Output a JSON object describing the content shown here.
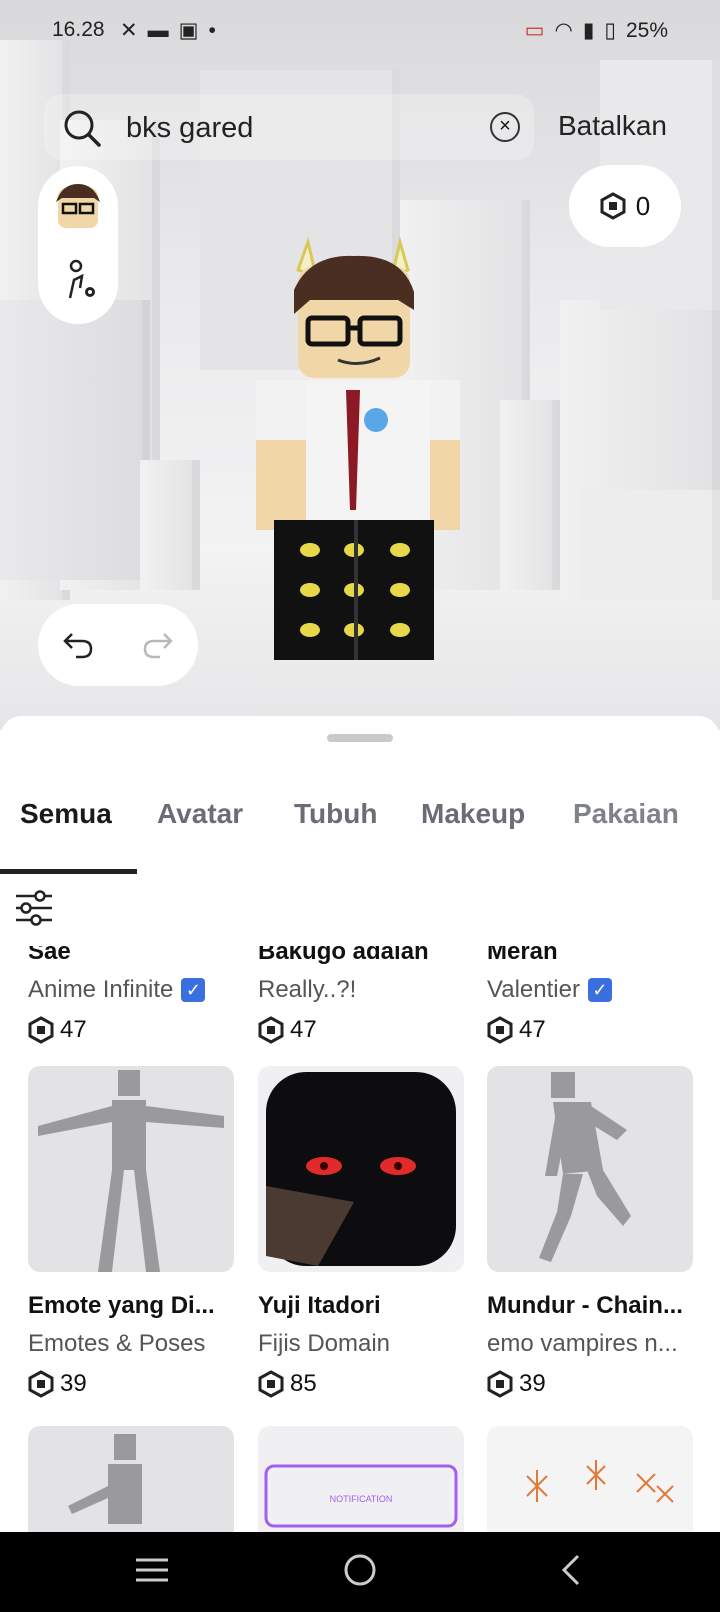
{
  "status_bar": {
    "time": "16.28",
    "battery": "25%"
  },
  "search": {
    "value": "bks gared",
    "cancel_label": "Batalkan"
  },
  "robux": {
    "balance": "0"
  },
  "tabs": [
    "Semua",
    "Avatar",
    "Tubuh",
    "Makeup",
    "Pakaian"
  ],
  "partial_row": [
    {
      "name": "Sae",
      "creator": "Anime Infinite",
      "verified": true,
      "price": "47"
    },
    {
      "name": "Bakugo adalah",
      "creator": "Really..?!",
      "verified": false,
      "price": "47"
    },
    {
      "name": "Meran",
      "creator": "Valentier",
      "verified": true,
      "price": "47"
    }
  ],
  "items": [
    {
      "name": "Emote yang Di...",
      "creator": "Emotes & Poses",
      "price": "39",
      "thumb": "pose-figure-icon"
    },
    {
      "name": "Yuji Itadori",
      "creator": "Fijis Domain",
      "price": "85",
      "thumb": "dark-mask-head-icon"
    },
    {
      "name": "Mundur - Chain...",
      "creator": "emo vampires n...",
      "price": "39",
      "thumb": "dance-figure-icon"
    }
  ],
  "bottom_row_text": "NOTIFICATION",
  "colors": {
    "accent_verified": "#3a6fe0",
    "scene_bg": "#e6e6e8"
  }
}
